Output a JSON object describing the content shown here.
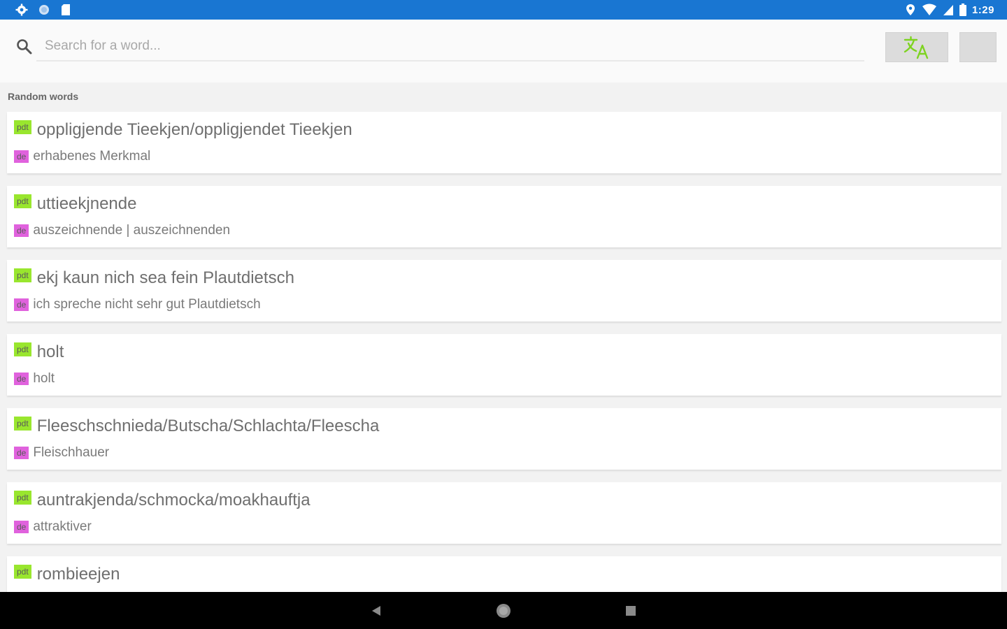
{
  "status_bar": {
    "time": "1:29",
    "left_icons": [
      "gear-icon",
      "circle-icon",
      "sd-card-icon"
    ],
    "right_icons": [
      "location-icon",
      "wifi-icon",
      "signal-icon",
      "battery-icon"
    ]
  },
  "search": {
    "placeholder": "Search for a word..."
  },
  "section": {
    "title": "Random words"
  },
  "languages": {
    "source": "pdt",
    "target": "de"
  },
  "entries": [
    {
      "word": "oppligjende Tieekjen/oppligjendet Tieekjen",
      "translation": "erhabenes Merkmal"
    },
    {
      "word": "uttieekjnende",
      "translation": "auszeichnende | auszeichnenden"
    },
    {
      "word": "ekj kaun nich sea fein Plautdietsch",
      "translation": "ich spreche nicht sehr gut Plautdietsch"
    },
    {
      "word": "holt",
      "translation": "holt"
    },
    {
      "word": "Fleeschschnieda/Butscha/Schlachta/Fleescha",
      "translation": "Fleischhauer"
    },
    {
      "word": "auntrakjenda/schmocka/moakhauftja",
      "translation": "attraktiver"
    },
    {
      "word": "rombieejen",
      "translation": ""
    }
  ],
  "colors": {
    "status_bar": "#1976d2",
    "badge_pdt": "#99e62e",
    "badge_de": "#e062dd",
    "translate_icon": "#7ed321"
  }
}
